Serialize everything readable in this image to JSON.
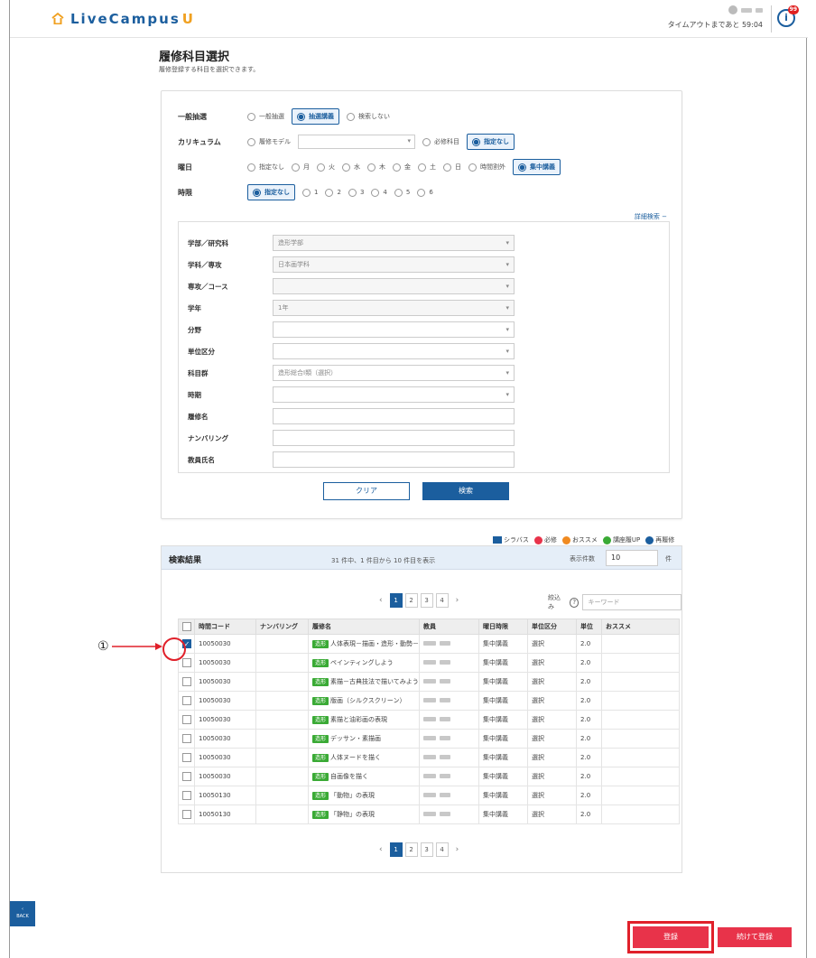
{
  "header": {
    "logo_main": "LiveCampus",
    "logo_accent": "U",
    "timeout": "タイムアウトまであと 59:04",
    "badge": "99"
  },
  "page": {
    "title": "履修科目選択",
    "subtitle": "履修登録する科目を選択できます。"
  },
  "search": {
    "rows": [
      {
        "label": "一般抽選",
        "options": [
          "一般抽選",
          "抽選講義",
          "検索しない"
        ],
        "selected": 1
      },
      {
        "label": "カリキュラム",
        "options": [
          "履修モデル",
          "必修科目",
          "指定なし"
        ],
        "selected": 2
      },
      {
        "label": "曜日",
        "options": [
          "指定なし",
          "月",
          "火",
          "水",
          "木",
          "金",
          "土",
          "日",
          "時間割外",
          "集中講義"
        ],
        "selected": 9
      },
      {
        "label": "時限",
        "options": [
          "指定なし",
          "1",
          "2",
          "3",
          "4",
          "5",
          "6"
        ],
        "selected": 0
      }
    ],
    "advanced_link": "詳細検索 −",
    "fields": [
      {
        "label": "学部／研究科",
        "value": "造形学部",
        "disabled": true
      },
      {
        "label": "学科／専攻",
        "value": "日本画学科",
        "disabled": true
      },
      {
        "label": "専攻／コース",
        "value": "",
        "disabled": true
      },
      {
        "label": "学年",
        "value": "1年",
        "disabled": true
      },
      {
        "label": "分野",
        "value": "",
        "disabled": false
      },
      {
        "label": "単位区分",
        "value": "",
        "disabled": false
      },
      {
        "label": "科目群",
        "value": "造形総合Ⅰ類（選択）",
        "disabled": false
      },
      {
        "label": "時期",
        "value": "",
        "disabled": false
      },
      {
        "label": "履修名",
        "value": "",
        "disabled": false
      },
      {
        "label": "ナンバリング",
        "value": "",
        "disabled": false
      },
      {
        "label": "教員氏名",
        "value": "",
        "disabled": false
      }
    ],
    "clear_label": "クリア",
    "search_label": "検索"
  },
  "legend": {
    "syllabus": "シラバス",
    "required": "必修",
    "recommend": "おススメ",
    "upgrade": "講座履UP",
    "retake": "再履修",
    "colors": {
      "syllabus": "#1b5e9e",
      "required": "#e8334a",
      "recommend": "#f08a20",
      "upgrade": "#3aaa35",
      "retake": "#1b5e9e"
    }
  },
  "results": {
    "title": "検索結果",
    "count_text": "31 件中、1 件目から 10 件目を表示",
    "display_label": "表示件数",
    "display_value": "10",
    "display_unit": "件",
    "filter_label": "絞込み",
    "filter_placeholder": "キーワード",
    "pages": [
      "1",
      "2",
      "3",
      "4"
    ],
    "current_page": "1",
    "columns": [
      "時間コード",
      "ナンバリング",
      "履修名",
      "教員",
      "曜日時限",
      "単位区分",
      "単位",
      "おススメ"
    ],
    "rows": [
      {
        "code": "10050030",
        "numbering": "",
        "tag": "造形",
        "name": "人体表現－描画・造形・動勢－",
        "schedule": "集中講義",
        "category": "選択",
        "units": "2.0",
        "checked": true
      },
      {
        "code": "10050030",
        "numbering": "",
        "tag": "造形",
        "name": "ペインティングしよう",
        "schedule": "集中講義",
        "category": "選択",
        "units": "2.0",
        "checked": false
      },
      {
        "code": "10050030",
        "numbering": "",
        "tag": "造形",
        "name": "素描－古典技法で描いてみよう",
        "schedule": "集中講義",
        "category": "選択",
        "units": "2.0",
        "checked": false
      },
      {
        "code": "10050030",
        "numbering": "",
        "tag": "造形",
        "name": "版画（シルクスクリーン）",
        "schedule": "集中講義",
        "category": "選択",
        "units": "2.0",
        "checked": false
      },
      {
        "code": "10050030",
        "numbering": "",
        "tag": "造形",
        "name": "素描と油彩画の表現",
        "schedule": "集中講義",
        "category": "選択",
        "units": "2.0",
        "checked": false
      },
      {
        "code": "10050030",
        "numbering": "",
        "tag": "造形",
        "name": "デッサン・素描画",
        "schedule": "集中講義",
        "category": "選択",
        "units": "2.0",
        "checked": false
      },
      {
        "code": "10050030",
        "numbering": "",
        "tag": "造形",
        "name": "人体ヌードを描く",
        "schedule": "集中講義",
        "category": "選択",
        "units": "2.0",
        "checked": false
      },
      {
        "code": "10050030",
        "numbering": "",
        "tag": "造形",
        "name": "自画像を描く",
        "schedule": "集中講義",
        "category": "選択",
        "units": "2.0",
        "checked": false
      },
      {
        "code": "10050130",
        "numbering": "",
        "tag": "造形",
        "name": "「動物」の表現",
        "schedule": "集中講義",
        "category": "選択",
        "units": "2.0",
        "checked": false
      },
      {
        "code": "10050130",
        "numbering": "",
        "tag": "造形",
        "name": "「静物」の表現",
        "schedule": "集中講義",
        "category": "選択",
        "units": "2.0",
        "checked": false
      }
    ]
  },
  "annotation": {
    "label": "①"
  },
  "footer": {
    "back_label": "BACK",
    "register_label": "登録",
    "continue_label": "続けて登録"
  }
}
